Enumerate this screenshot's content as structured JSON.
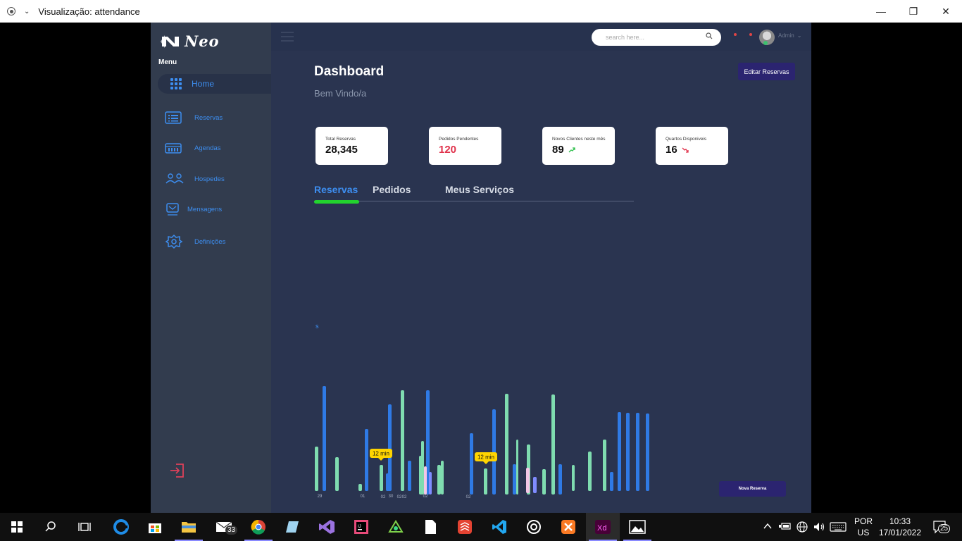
{
  "window": {
    "title": "Visualização: attendance"
  },
  "sidebar": {
    "logo_text": "Neo",
    "menu_title": "Menu",
    "home_label": "Home",
    "items": [
      {
        "label": "Reservas",
        "icon": "list-icon"
      },
      {
        "label": "Agendas",
        "icon": "calendar-icon"
      },
      {
        "label": "Hospedes",
        "icon": "users-icon"
      },
      {
        "label": "Mensagens",
        "icon": "message-icon"
      },
      {
        "label": "Definições",
        "icon": "settings-icon"
      }
    ]
  },
  "topbar": {
    "search_placeholder": "search here...",
    "user_name": "Admin"
  },
  "header": {
    "title": "Dashboard",
    "subtitle": "Bem Vindo/a",
    "edit_button": "Editar Reservas"
  },
  "cards": [
    {
      "label": "Total Reservas",
      "value": "28,345",
      "value_color": "#111111"
    },
    {
      "label": "Pedidos Pendentes",
      "value": "120",
      "value_color": "#e0334c"
    },
    {
      "label": "Novos Clientes neste mês",
      "value": "89",
      "trend": "up"
    },
    {
      "label": "Quartos Disponiveis",
      "value": "16",
      "trend": "down"
    }
  ],
  "tabs": [
    {
      "label": "Reservas",
      "active": true
    },
    {
      "label": "Pedidos",
      "active": false
    },
    {
      "label": "Meus Serviços",
      "active": false
    }
  ],
  "chart": {
    "axis_label": "s",
    "tooltips": [
      "12 min",
      "12 min"
    ],
    "tick_labels": [
      "29",
      "01",
      "02",
      "30",
      "02",
      "02",
      "02",
      "02"
    ],
    "colors": {
      "blue": "#2f7ae5",
      "green": "#7fdcb0",
      "pink": "#f3c6e6",
      "violet": "#7f8cff"
    }
  },
  "novo_button": "Nova Reserva",
  "taskbar": {
    "mail_badge": "33",
    "lang_top": "POR",
    "lang_bottom": "US",
    "time": "10:33",
    "date": "17/01/2022",
    "notifications": "25"
  }
}
